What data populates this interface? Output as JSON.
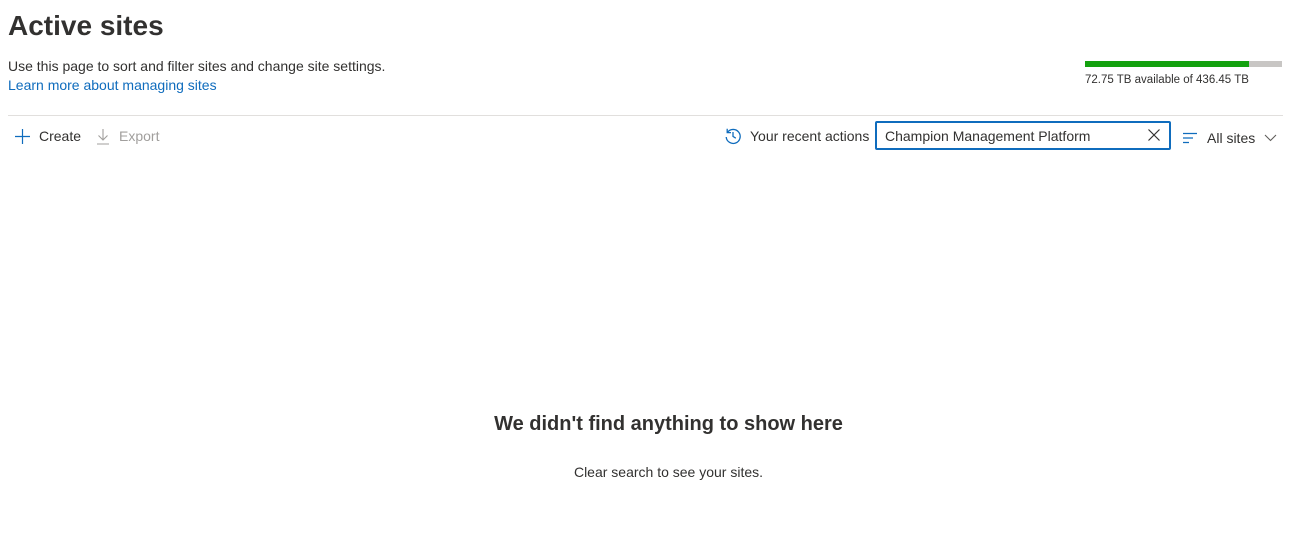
{
  "page": {
    "title": "Active sites",
    "description": "Use this page to sort and filter sites and change site settings.",
    "learn_more_link": "Learn more about managing sites"
  },
  "storage": {
    "label": "72.75 TB available of 436.45 TB",
    "used_fraction": 0.833,
    "used_color": "#13a10e",
    "track_color": "#c8c6c4"
  },
  "toolbar": {
    "create_label": "Create",
    "export_label": "Export",
    "recent_actions_label": "Your recent actions",
    "search_value": "Champion Management Platform",
    "view_label": "All sites"
  },
  "icons": {
    "create": "plus-icon",
    "export": "download-arrow-icon",
    "recent": "history-icon",
    "clear": "close-icon",
    "view": "filter-lines-icon",
    "dropdown": "chevron-down-icon"
  },
  "empty_state": {
    "title": "We didn't find anything to show here",
    "subtitle": "Clear search to see your sites."
  },
  "colors": {
    "accent": "#0f6cbd",
    "text": "#323130",
    "disabled": "#a19f9d"
  }
}
